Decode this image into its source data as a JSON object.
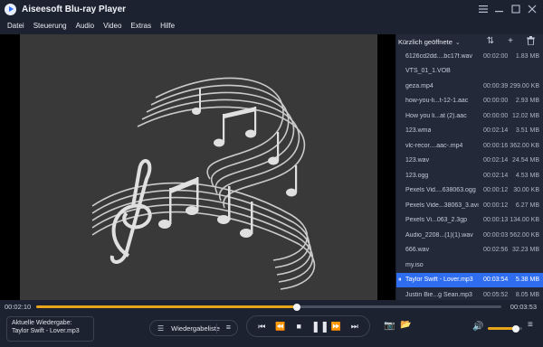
{
  "app": {
    "title": "Aiseesoft Blu-ray Player"
  },
  "window_controls": {
    "menu_icon": "hamburger-icon",
    "minimize_icon": "minimize-icon",
    "maximize_icon": "maximize-icon",
    "close_icon": "close-icon"
  },
  "menu": [
    "Datei",
    "Steuerung",
    "Audio",
    "Video",
    "Extras",
    "Hilfe"
  ],
  "playlist": {
    "header": "Kürzlich geöffnete",
    "items": [
      {
        "name": "6126cd2dd....bc17f.wav",
        "duration": "00:02:00",
        "size": "1.83 MB"
      },
      {
        "name": "VTS_01_1.VOB",
        "duration": "",
        "size": ""
      },
      {
        "name": "geza.mp4",
        "duration": "00:00:39",
        "size": "299.00 KB"
      },
      {
        "name": "how-you-li...t-12-1.aac",
        "duration": "00:00:00",
        "size": "2.93 MB"
      },
      {
        "name": "How you li...at (2).aac",
        "duration": "00:00:00",
        "size": "12.02 MB"
      },
      {
        "name": "123.wma",
        "duration": "00:02:14",
        "size": "3.51 MB"
      },
      {
        "name": "vlc-recor....aac-.mp4",
        "duration": "00:00:16",
        "size": "362.00 KB"
      },
      {
        "name": "123.wav",
        "duration": "00:02:14",
        "size": "24.54 MB"
      },
      {
        "name": "123.ogg",
        "duration": "00:02:14",
        "size": "4.53 MB"
      },
      {
        "name": "Pexels Vid....638063.ogg",
        "duration": "00:00:12",
        "size": "30.00 KB"
      },
      {
        "name": "Pexels Vide...38063_3.avi",
        "duration": "00:00:12",
        "size": "6.27 MB"
      },
      {
        "name": "Pexels Vi...063_2.3gp",
        "duration": "00:00:13",
        "size": "134.00 KB"
      },
      {
        "name": "Audio_2208...(1)(1).wav",
        "duration": "00:00:03",
        "size": "562.00 KB"
      },
      {
        "name": "666.wav",
        "duration": "00:02:56",
        "size": "32.23 MB"
      },
      {
        "name": "my.iso",
        "duration": "",
        "size": ""
      },
      {
        "name": "Taylor Swift - Lover.mp3",
        "duration": "00:03:54",
        "size": "5.38 MB",
        "active": true
      },
      {
        "name": "Justin Bie...g Sean.mp3",
        "duration": "00:05:52",
        "size": "8.05 MB"
      }
    ]
  },
  "progress": {
    "current": "00:02:10",
    "total": "00:03:53",
    "fraction": 0.56
  },
  "now_playing": {
    "label": "Aktuelle Wiedergabe:",
    "title": "Taylor Swift - Lover.mp3"
  },
  "controls": {
    "playlist_label": "Wiedergabeliste"
  },
  "volume": {
    "level": 0.82
  },
  "colors": {
    "accent": "#e8a41a",
    "selection": "#2e6cf0",
    "background": "#1d2230"
  }
}
